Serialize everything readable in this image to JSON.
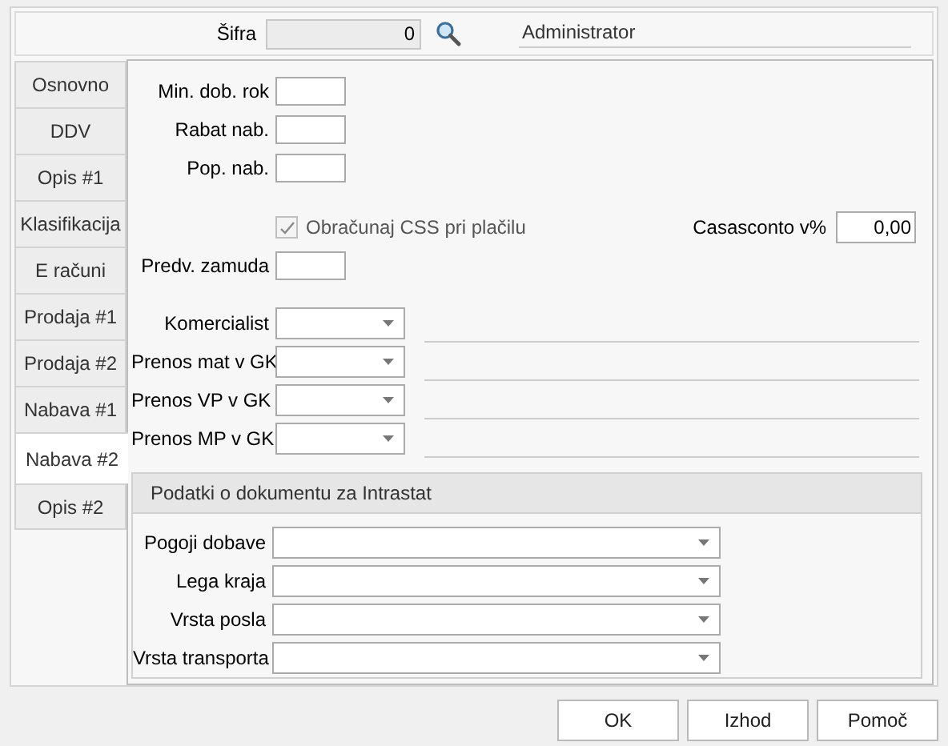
{
  "header": {
    "label": "Šifra",
    "value": "0",
    "name": "Administrator"
  },
  "tabs": [
    {
      "label": "Osnovno",
      "selected": false
    },
    {
      "label": "DDV",
      "selected": false
    },
    {
      "label": "Opis #1",
      "selected": false
    },
    {
      "label": "Klasifikacija",
      "selected": false
    },
    {
      "label": "E računi",
      "selected": false
    },
    {
      "label": "Prodaja #1",
      "selected": false
    },
    {
      "label": "Prodaja #2",
      "selected": false
    },
    {
      "label": "Nabava #1",
      "selected": false
    },
    {
      "label": "Nabava #2",
      "selected": true
    },
    {
      "label": "Opis #2",
      "selected": false
    }
  ],
  "fields": [
    {
      "label": "Min. dob. rok"
    },
    {
      "label": "Rabat nab."
    },
    {
      "label": "Pop. nab."
    }
  ],
  "checkbox": {
    "label": "Obračunaj CSS pri plačilu",
    "checked": true,
    "disabled": true
  },
  "casasconto": {
    "label": "Casasconto v%",
    "value": "0,00"
  },
  "delay": {
    "label": "Predv. zamuda"
  },
  "accounts": [
    {
      "label": "Komercialist"
    },
    {
      "label": "Prenos mat v GK"
    },
    {
      "label": "Prenos VP v GK"
    },
    {
      "label": "Prenos MP v GK"
    }
  ],
  "intrastat": {
    "title": "Podatki o dokumentu za Intrastat",
    "fields": [
      {
        "label": "Pogoji dobave"
      },
      {
        "label": "Lega kraja"
      },
      {
        "label": "Vrsta posla"
      },
      {
        "label": "Vrsta transporta"
      }
    ]
  },
  "buttons": [
    "OK",
    "Izhod",
    "Pomoč"
  ]
}
